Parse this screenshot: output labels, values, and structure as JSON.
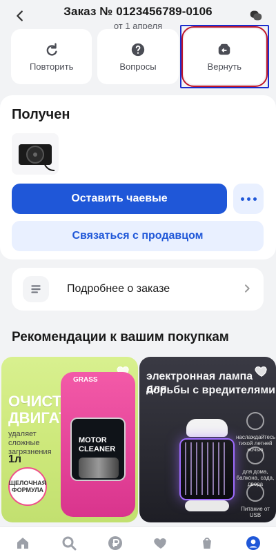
{
  "header": {
    "title": "Заказ № 0123456789-0106",
    "subtitle": "от 1 апреля"
  },
  "actions": [
    {
      "label": "Повторить"
    },
    {
      "label": "Вопросы"
    },
    {
      "label": "Вернуть"
    }
  ],
  "order": {
    "status": "Получен",
    "tip_button": "Оставить чаевые",
    "contact_seller": "Связаться с продавцом"
  },
  "details": {
    "label": "Подробнее о заказе"
  },
  "recommendations": {
    "title": "Рекомендации к вашим покупкам",
    "products": [
      {
        "line1": "ОЧИСТИТЕЛЬ",
        "line2": "ДВИГАТЕЛЯ",
        "small1": "удаляет",
        "small2": "сложные",
        "small3": "загрязнения",
        "volume": "1л",
        "badge1": "ЩЕЛОЧНАЯ",
        "badge2": "ФОРМУЛА",
        "brand": "GRASS",
        "mc1": "MOTOR",
        "mc2": "CLEANER"
      },
      {
        "t1": "электронная лампа для",
        "t2": "борьбы с вредителями",
        "f1": "наслаждайтесь тихой летней ночью",
        "f2": "для дома, балкона, сада, двора",
        "f3": "Питание от USB"
      }
    ]
  },
  "tabbar": {
    "items": [
      "home-icon",
      "search-icon",
      "ruble-icon",
      "heart-icon",
      "basket-icon",
      "profile-icon"
    ]
  },
  "colors": {
    "accent": "#1f57d8",
    "bg": "#f2f3f5"
  }
}
